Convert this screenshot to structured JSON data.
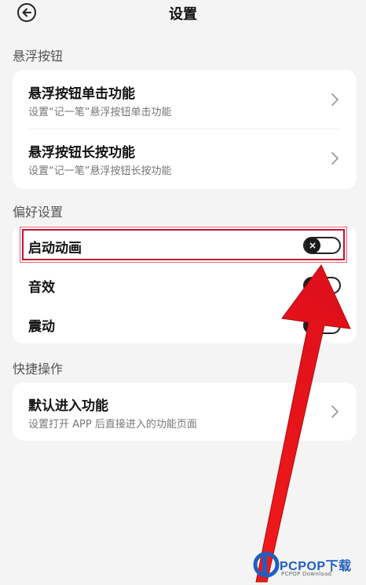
{
  "header": {
    "title": "设置"
  },
  "sections": {
    "float": {
      "label": "悬浮按钮",
      "items": [
        {
          "title": "悬浮按钮单击功能",
          "subtitle": "设置“记一笔”悬浮按钮单击功能"
        },
        {
          "title": "悬浮按钮长按功能",
          "subtitle": "设置“记一笔”悬浮按钮长按功能"
        }
      ]
    },
    "prefs": {
      "label": "偏好设置",
      "items": [
        {
          "title": "启动动画",
          "toggle_on": false,
          "knob_glyph": "×"
        },
        {
          "title": "音效",
          "toggle_on": false
        },
        {
          "title": "震动",
          "toggle_on": false
        }
      ]
    },
    "shortcut": {
      "label": "快捷操作",
      "items": [
        {
          "title": "默认进入功能",
          "subtitle": "设置打开 APP 后直接进入的功能页面"
        }
      ]
    }
  },
  "watermark": {
    "brand": "PCPOP下载",
    "sub": "PCPOP Download"
  },
  "colors": {
    "annotation_red": "#e8141c",
    "highlight_border": "#c8102e",
    "brand_blue": "#1e5fbf"
  }
}
